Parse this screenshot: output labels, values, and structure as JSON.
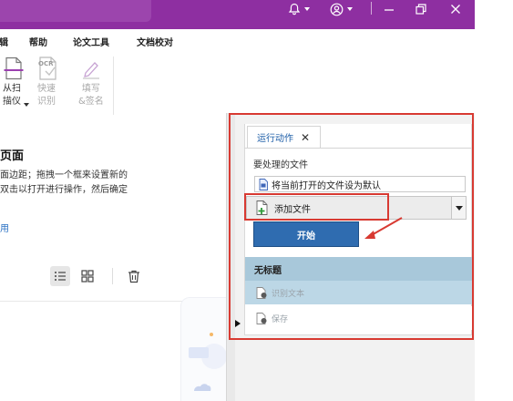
{
  "menu": {
    "items": [
      "辑",
      "帮助",
      "论文工具",
      "文档校对"
    ]
  },
  "ribbon": {
    "scan_label": "从扫\n描仪",
    "ocr_icon_text": "OCR",
    "quick_ocr_label": "快速\n识别",
    "sign_label": "填写\n&签名"
  },
  "left": {
    "title": "页面",
    "desc_1": "面边距；拖拽一个框来设置新的",
    "desc_2": "双击以打开进行操作，然后确定",
    "link": "用"
  },
  "panel": {
    "tab_label": "运行动作",
    "files_label": "要处理的文件",
    "default_file_option": "将当前打开的文件设为默认",
    "add_file_label": "添加文件",
    "start_label": "开始",
    "sequence_title": "无标题",
    "step_ocr": "识别文本",
    "step_save": "保存"
  },
  "colors": {
    "titlebar": "#8e2fa1",
    "accent_blue": "#2f6cb0",
    "annotation_red": "#d83a32",
    "sequence_header": "#a8c8da"
  }
}
